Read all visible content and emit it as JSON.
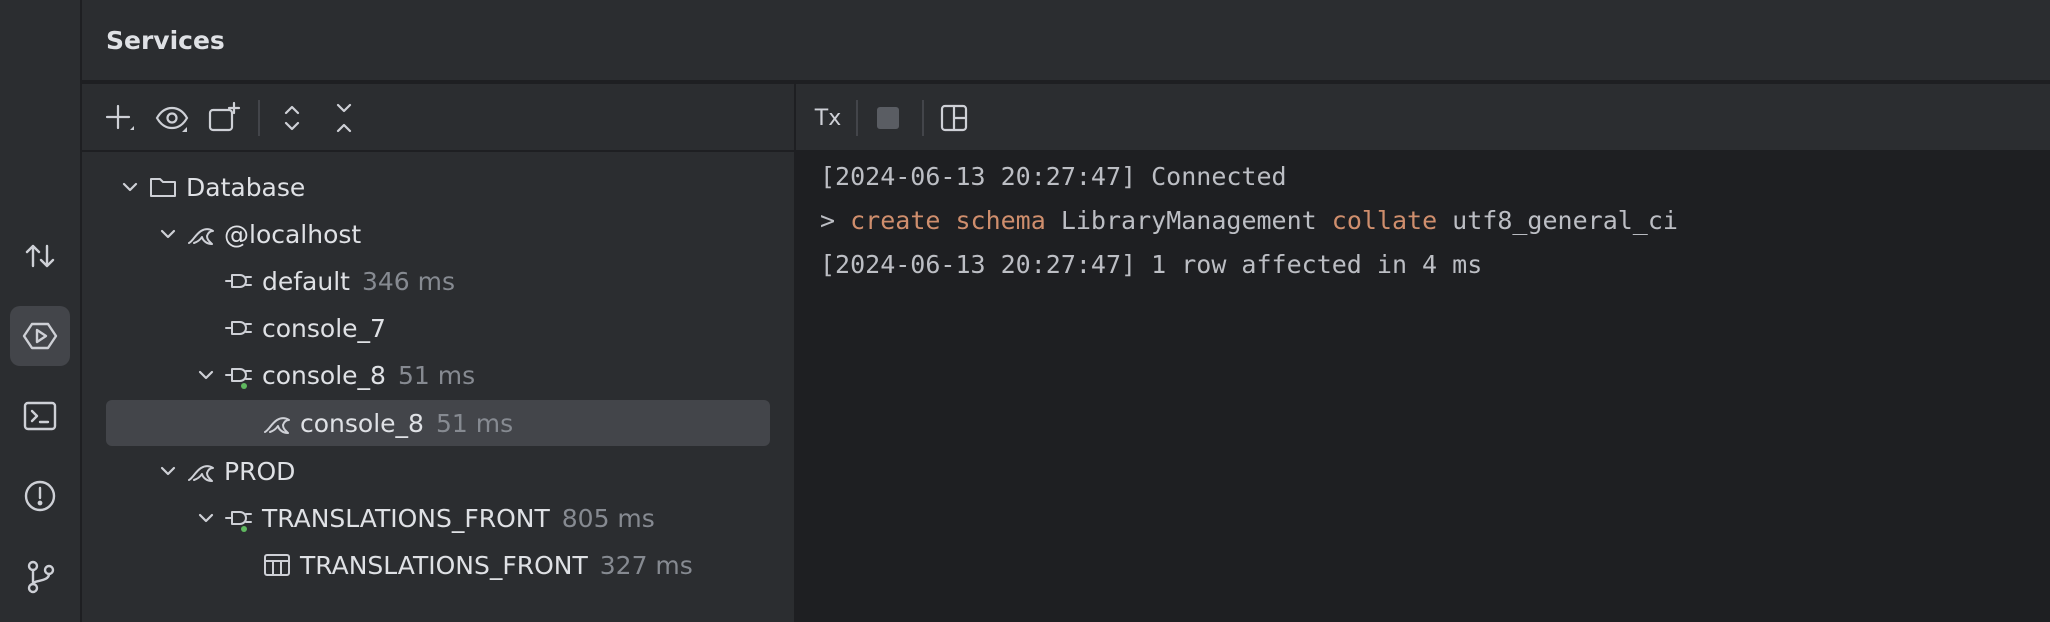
{
  "panel": {
    "title": "Services"
  },
  "left_strip": {
    "icons": [
      "transfer-icon",
      "services-icon",
      "terminal-icon",
      "problems-icon",
      "git-icon"
    ],
    "active": "services-icon"
  },
  "tree_toolbar": {
    "icons": [
      "add-icon",
      "view-options-icon",
      "new-group-icon",
      "expand-all-icon",
      "collapse-all-icon"
    ]
  },
  "console_toolbar": {
    "tx_label": "Tx",
    "icons": [
      "tx-mode-icon",
      "stop-icon",
      "layout-icon"
    ]
  },
  "tree": {
    "database": {
      "label": "Database"
    },
    "localhost": {
      "label": "@localhost"
    },
    "default": {
      "label": "default",
      "time": "346 ms"
    },
    "console7": {
      "label": "console_7"
    },
    "console8": {
      "label": "console_8",
      "time": "51 ms"
    },
    "console8_child": {
      "label": "console_8",
      "time": "51 ms"
    },
    "prod": {
      "label": "PROD"
    },
    "translations_front": {
      "label": "TRANSLATIONS_FRONT",
      "time": "805 ms"
    },
    "translations_front_table": {
      "label": "TRANSLATIONS_FRONT",
      "time": "327 ms"
    }
  },
  "console": {
    "line1": "[2024-06-13 20:27:47] Connected",
    "line2": {
      "prompt": "> ",
      "kw1": "create schema",
      "name": " LibraryManagement ",
      "kw2": "collate",
      "rest": " utf8_general_ci"
    },
    "line3": "[2024-06-13 20:27:47] 1 row affected in 4 ms"
  },
  "colors": {
    "background": "#1e1f22",
    "panel": "#2b2d30",
    "selection": "#43454a",
    "keyword": "#cf8e6d",
    "muted": "#868a91",
    "status_green": "#5fb85f"
  }
}
